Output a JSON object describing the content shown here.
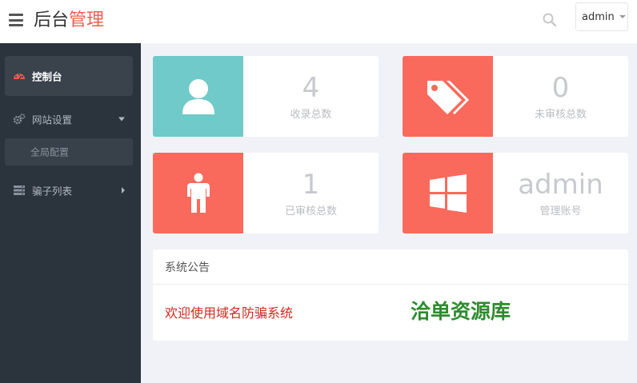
{
  "header": {
    "brand_main": "后台",
    "brand_accent": "管理",
    "user_label": "admin"
  },
  "sidebar": {
    "items": [
      {
        "label": "控制台",
        "icon": "dashboard-icon",
        "active": true
      },
      {
        "label": "网站设置",
        "icon": "gears-icon",
        "expanded": true,
        "children": [
          {
            "label": "全局配置"
          }
        ]
      },
      {
        "label": "骗子列表",
        "icon": "server-list-icon"
      }
    ]
  },
  "stats": [
    {
      "value": "4",
      "caption": "收录总数",
      "icon": "user-icon",
      "color": "#6fcac9"
    },
    {
      "value": "0",
      "caption": "未审核总数",
      "icon": "tags-icon",
      "color": "#f96a5d"
    },
    {
      "value": "1",
      "caption": "已审核总数",
      "icon": "male-icon",
      "color": "#f96a5d"
    },
    {
      "value": "admin",
      "caption": "管理账号",
      "icon": "windows-icon",
      "color": "#f96a5d"
    }
  ],
  "notice": {
    "title": "系统公告",
    "welcome": "欢迎使用域名防骗系统",
    "resource": "洽单资源库"
  },
  "colors": {
    "accent": "#f05b4f",
    "sidebar_bg": "#2b333d",
    "teal": "#6fcac9",
    "salmon": "#f96a5d"
  }
}
